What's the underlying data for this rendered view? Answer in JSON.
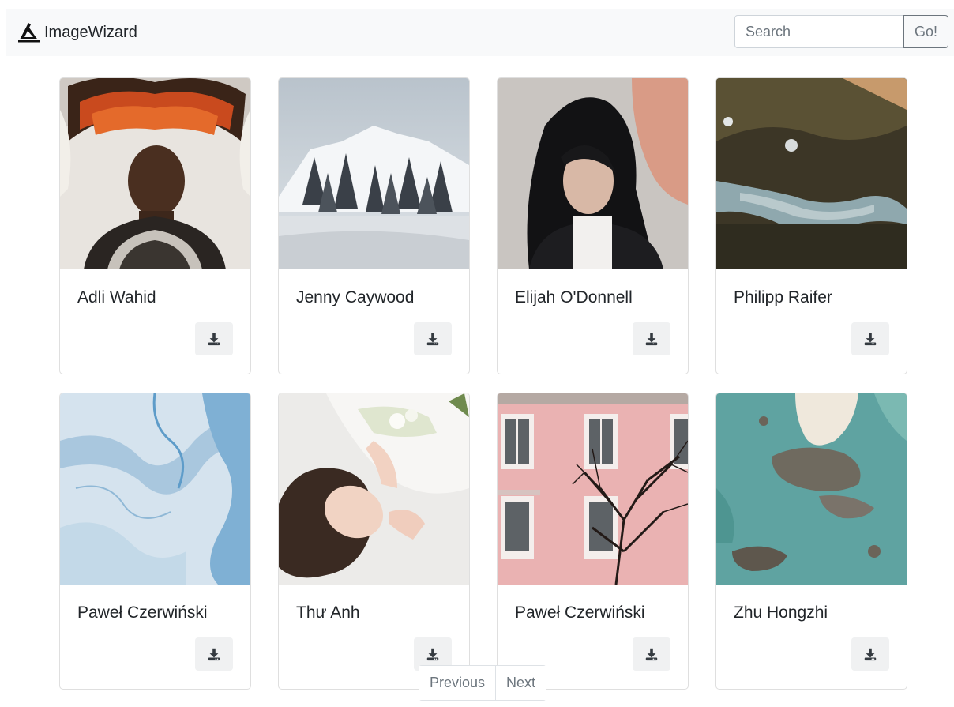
{
  "navbar": {
    "brand": "ImageWizard",
    "brand_icon": "wizard-hat-icon",
    "search_placeholder": "Search",
    "search_value": "",
    "go_label": "Go!"
  },
  "cards": [
    {
      "author": "Adli Wahid",
      "image": "man-feather-headdress"
    },
    {
      "author": "Jenny Caywood",
      "image": "snowy-mountain-forest"
    },
    {
      "author": "Elijah O'Donnell",
      "image": "woman-dark-hair-portrait"
    },
    {
      "author": "Philipp Raifer",
      "image": "aerial-forest-lake"
    },
    {
      "author": "Paweł Czerwiński",
      "image": "blue-ice-texture"
    },
    {
      "author": "Thư Anh",
      "image": "woman-lying-with-flowers"
    },
    {
      "author": "Paweł Czerwiński",
      "image": "pink-building-tree"
    },
    {
      "author": "Zhu Hongzhi",
      "image": "aerial-turquoise-sea-rocks"
    }
  ],
  "download_icon": "download-icon",
  "pagination": {
    "previous_label": "Previous",
    "next_label": "Next"
  },
  "colors": {
    "navbar_bg": "#f8f9fa",
    "button_bg": "#f0f1f2",
    "border": "#dfdfdf",
    "text": "#212529",
    "muted": "#6c757d"
  }
}
